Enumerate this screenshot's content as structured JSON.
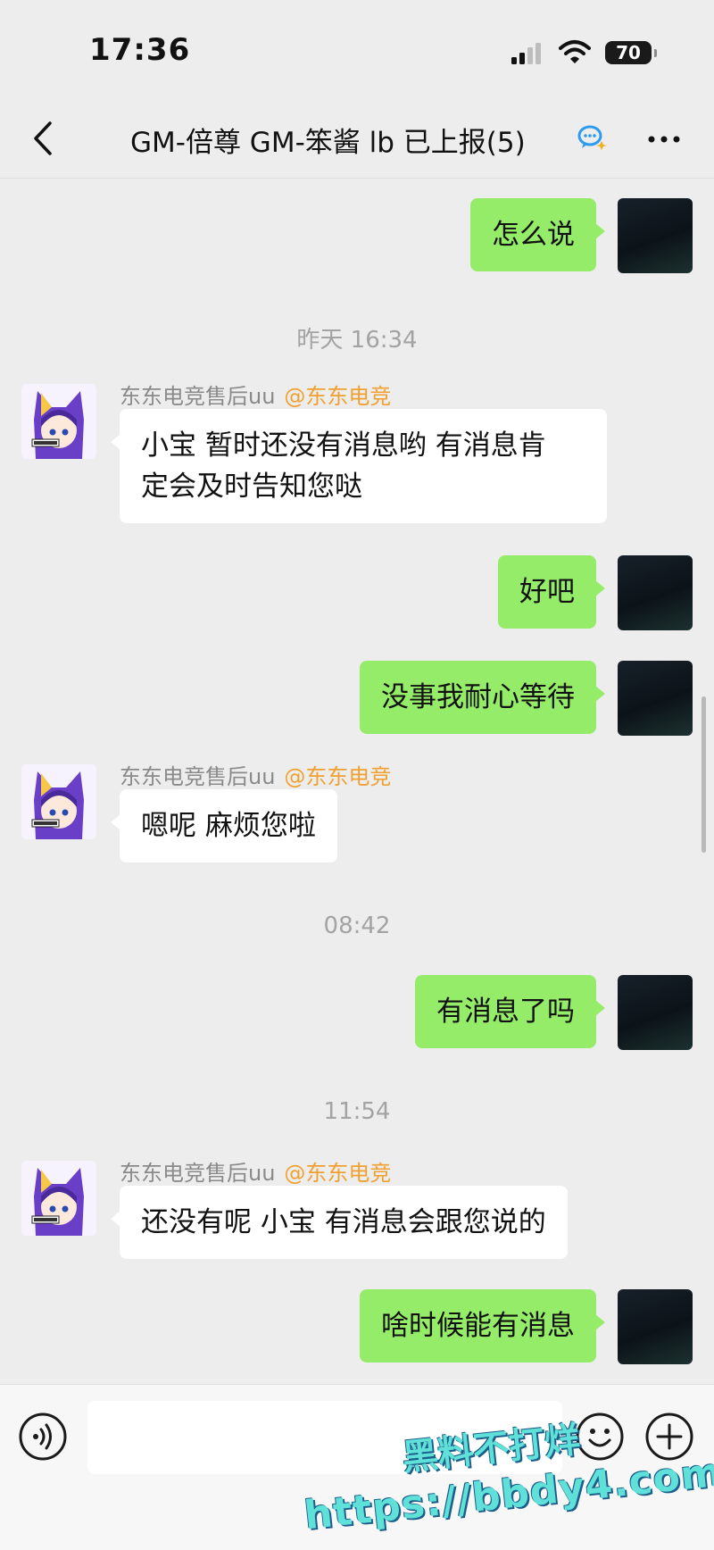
{
  "status_bar": {
    "time": "17:36",
    "battery": "70"
  },
  "header": {
    "title": "GM-倍尊 GM-笨酱 lb 已上报(5)"
  },
  "messages": {
    "m1": {
      "text": "怎么说"
    },
    "ts1": {
      "text": "昨天 16:34"
    },
    "m2": {
      "sender": "东东电竞售后uu",
      "tag": "@东东电竞",
      "text1": "小宝 暂时还没有消息哟 有消息肯",
      "text2": "定会及时告知您哒"
    },
    "m3": {
      "text": "好吧"
    },
    "m4": {
      "text": "没事我耐心等待"
    },
    "m5": {
      "sender": "东东电竞售后uu",
      "tag": "@东东电竞",
      "text": "嗯呢 麻烦您啦"
    },
    "ts2": {
      "text": "08:42"
    },
    "m6": {
      "text": "有消息了吗"
    },
    "ts3": {
      "text": "11:54"
    },
    "m7": {
      "sender": "东东电竞售后uu",
      "tag": "@东东电竞",
      "text": "还没有呢 小宝 有消息会跟您说的"
    },
    "m8": {
      "text": "啥时候能有消息"
    }
  },
  "input_bar": {
    "placeholder": ""
  },
  "watermark": {
    "line1": "黑料不打烊",
    "line2": "https://bbdy4.com"
  },
  "icons": [
    "signal-icon",
    "wifi-icon",
    "battery-icon",
    "back-arrow-icon",
    "chat-bubble-icon",
    "more-dots-icon",
    "voice-icon",
    "emoji-icon",
    "plus-icon"
  ],
  "colors": {
    "background": "#ededed",
    "self_bubble": "#95ec69",
    "other_bubble": "#ffffff",
    "tag": "#f0a030",
    "timestamp": "#a3a3a3"
  }
}
